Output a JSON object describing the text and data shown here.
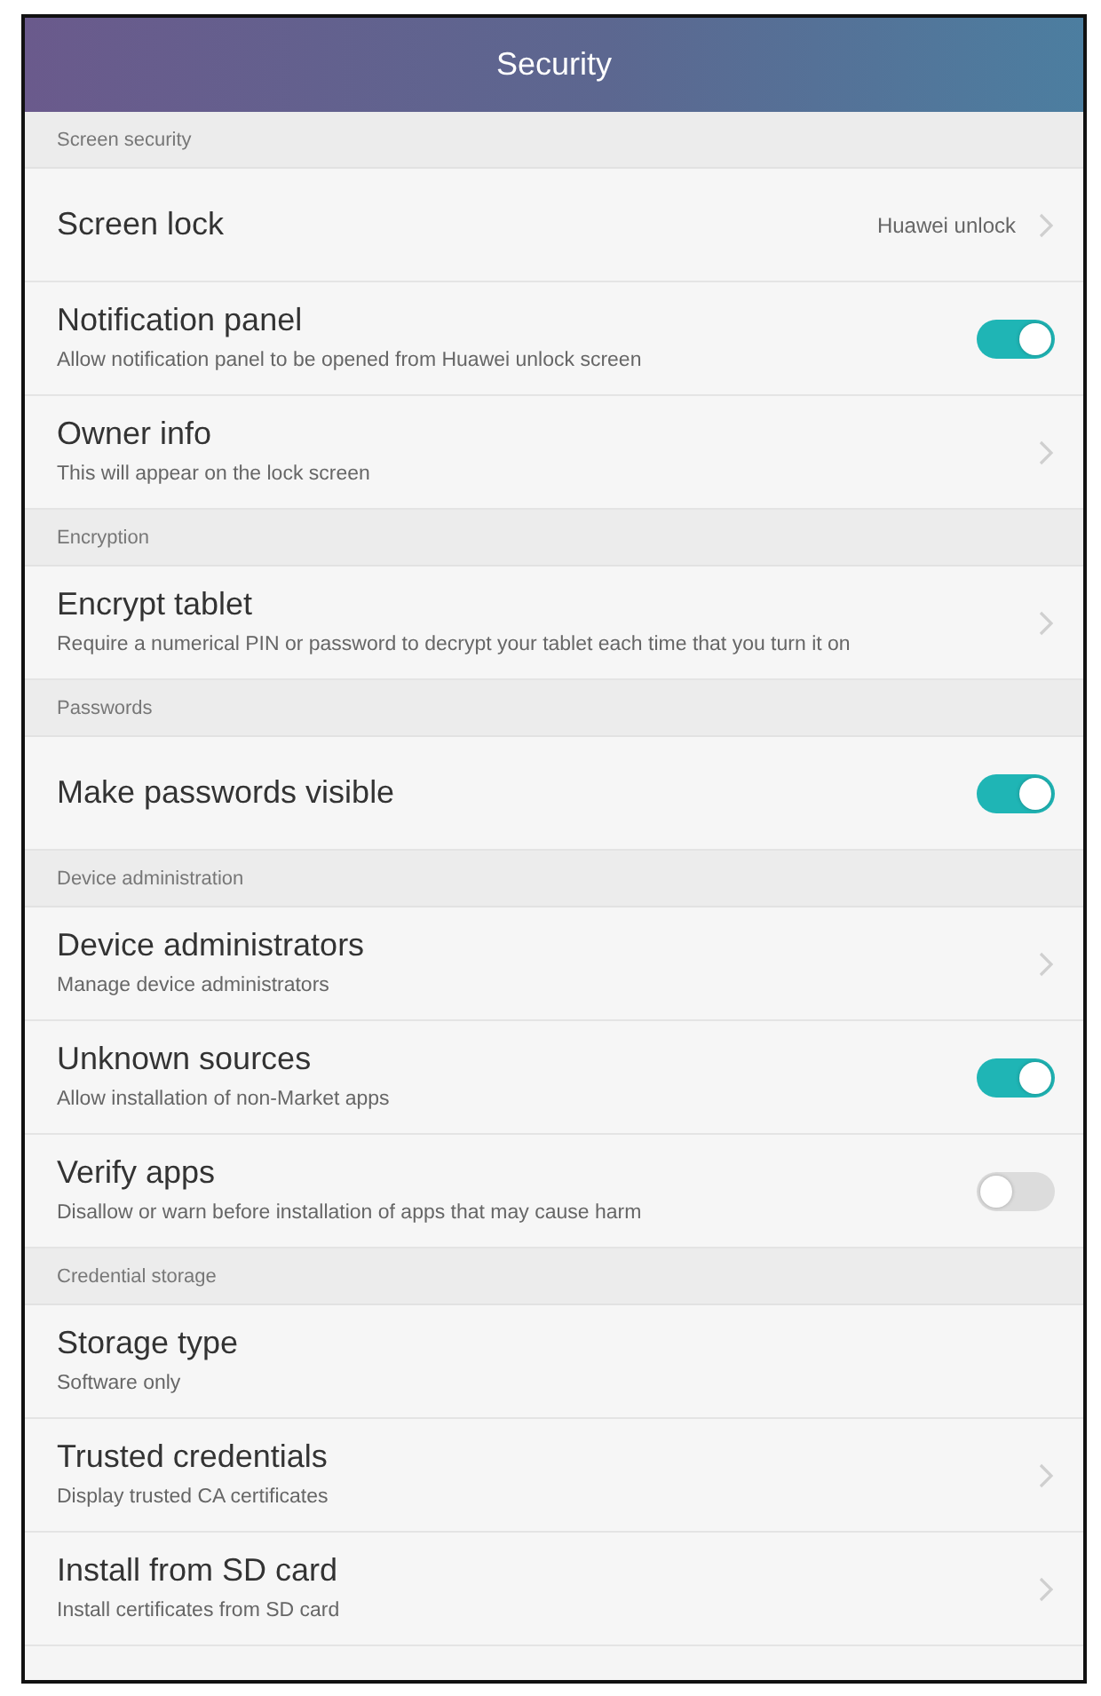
{
  "header": {
    "title": "Security"
  },
  "sections": [
    {
      "title": "Screen security",
      "rows": [
        {
          "kind": "chevron",
          "title": "Screen lock",
          "value": "Huawei unlock"
        },
        {
          "kind": "toggle",
          "title": "Notification panel",
          "subtitle": "Allow notification panel to be opened from Huawei unlock screen",
          "on": true
        },
        {
          "kind": "chevron",
          "title": "Owner info",
          "subtitle": "This will appear on the lock screen"
        }
      ]
    },
    {
      "title": "Encryption",
      "rows": [
        {
          "kind": "chevron",
          "title": "Encrypt tablet",
          "subtitle": "Require a numerical PIN or password to decrypt your tablet each time that you turn it on"
        }
      ]
    },
    {
      "title": "Passwords",
      "rows": [
        {
          "kind": "toggle",
          "title": "Make passwords visible",
          "on": true
        }
      ]
    },
    {
      "title": "Device administration",
      "rows": [
        {
          "kind": "chevron",
          "title": "Device administrators",
          "subtitle": "Manage device administrators"
        },
        {
          "kind": "toggle",
          "title": "Unknown sources",
          "subtitle": "Allow installation of non-Market apps",
          "on": true
        },
        {
          "kind": "toggle",
          "title": "Verify apps",
          "subtitle": "Disallow or warn before installation of apps that may cause harm",
          "on": false
        }
      ]
    },
    {
      "title": "Credential storage",
      "rows": [
        {
          "kind": "plain",
          "title": "Storage type",
          "subtitle": "Software only"
        },
        {
          "kind": "chevron",
          "title": "Trusted credentials",
          "subtitle": "Display trusted CA certificates"
        },
        {
          "kind": "chevron",
          "title": "Install from SD card",
          "subtitle": "Install certificates from SD card"
        }
      ]
    }
  ]
}
